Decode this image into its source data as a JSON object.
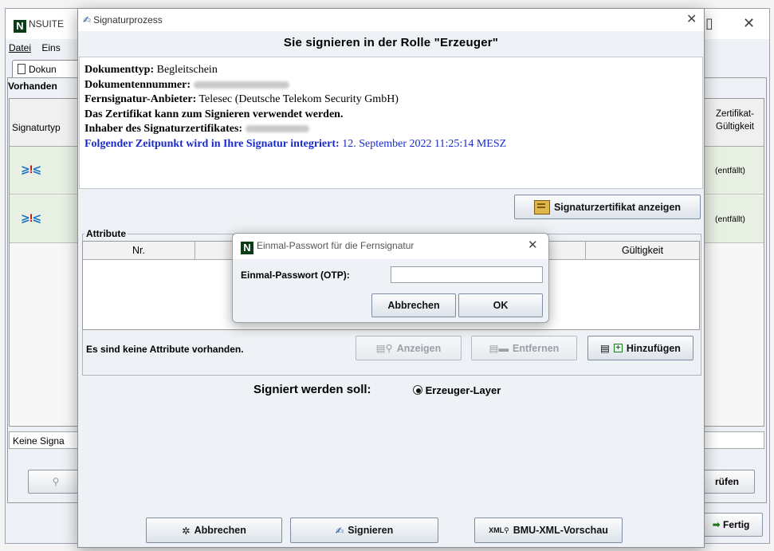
{
  "background_window": {
    "title": "NSUITE",
    "menu": [
      "Datei",
      "Eins"
    ],
    "tab_label": "Dokun",
    "group_label": "Vorhanden",
    "col_signaturtyp": "Signaturtyp",
    "col_zertifikat_line1": "Zertifikat-",
    "col_zertifikat_line2": "Gültigkeit",
    "row_value": "(entfällt)",
    "status_text": "Keine Signa",
    "pruefen_label": "rüfen",
    "fertig_label": "Fertig",
    "close_glyph": "✕"
  },
  "dialog": {
    "title": "Signaturprozess",
    "heading": "Sie signieren in der Rolle \"Erzeuger\"",
    "close_glyph": "✕",
    "info": {
      "doktyp_label": "Dokumenttyp:",
      "doktyp_value": "Begleitschein",
      "doknr_label": "Dokumentennummer:",
      "anbieter_label": "Fernsignatur-Anbieter:",
      "anbieter_value": "Telesec (Deutsche Telekom Security GmbH)",
      "zert_ok": "Das Zertifikat kann zum Signieren verwendet werden.",
      "inhaber_label": "Inhaber des Signaturzertifikates:",
      "zeitpunkt_label": "Folgender Zeitpunkt wird in Ihre Signatur integriert:",
      "zeitpunkt_value": "12. September 2022 11:25:14 MESZ"
    },
    "show_cert_button": "Signaturzertifikat anzeigen",
    "attributes": {
      "label": "Attribute",
      "col_nr": "Nr.",
      "col_gueltigkeit": "Gültigkeit",
      "empty_text": "Es sind keine Attribute vorhanden.",
      "anzeigen": "Anzeigen",
      "entfernen": "Entfernen",
      "hinzufuegen": "Hinzufügen"
    },
    "signed_label": "Signiert werden soll:",
    "radio_option": "Erzeuger-Layer",
    "footer": {
      "abbrechen": "Abbrechen",
      "signieren": "Signieren",
      "xml_preview": "BMU-XML-Vorschau"
    }
  },
  "otp_dialog": {
    "title": "Einmal-Passwort für die Fernsignatur",
    "field_label": "Einmal-Passwort (OTP):",
    "field_value": "",
    "cancel": "Abbrechen",
    "ok": "OK",
    "close_glyph": "✕"
  },
  "colors": {
    "accent_blue": "#1a2ac8",
    "logo_green": "#0c3b17",
    "row_green": "#e7f0e3"
  }
}
